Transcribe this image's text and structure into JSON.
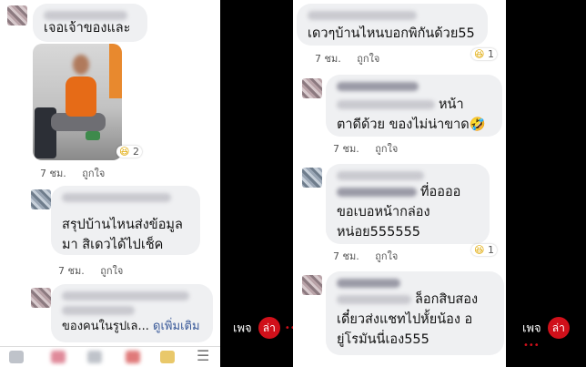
{
  "left": {
    "comments": [
      {
        "text": "เจอเจ้าของและ",
        "reaction_count": "2",
        "time": "7 ชม.",
        "like": "ถูกใจ"
      },
      {
        "text": "สรุปบ้านไหนส่งข้อมูลมา สิเดวได้ไปเช็ค",
        "time": "7 ชม.",
        "like": "ถูกใจ"
      },
      {
        "text": "ของคนในรูปเล...",
        "see_more": "ดูเพิ่มเติม"
      }
    ]
  },
  "right": {
    "comments": [
      {
        "text": "เดวๆบ้านไหนบอกพิกันด้วย55",
        "reaction_count": "1",
        "time": "7 ชม.",
        "like": "ถูกใจ"
      },
      {
        "text_line1": "หน้า",
        "text_line2": "ตาดีด้วย ของไม่น่าขาด🤣",
        "time": "7 ชม.",
        "like": "ถูกใจ"
      },
      {
        "text_line1": "ที่ออออ",
        "text_line2": "ขอเบอหน้ากล่อง",
        "text_line3": "หน่อย555555",
        "reaction_count": "1",
        "time": "7 ชม.",
        "like": "ถูกใจ"
      },
      {
        "text_line1": "ล็อกสิบสอง",
        "text_line2": "เดี๋ยวส่งแชทไปหั้ยน้อง อ",
        "text_line3": "ยู่โรมันนี่เอง555"
      }
    ]
  },
  "watermark": {
    "word": "เพจ",
    "mark": "ล่า",
    "dots": "•••"
  },
  "colors": {
    "bubble": "#eff0f2",
    "link": "#385898",
    "brand": "#d0101a",
    "divider": "#000000"
  }
}
